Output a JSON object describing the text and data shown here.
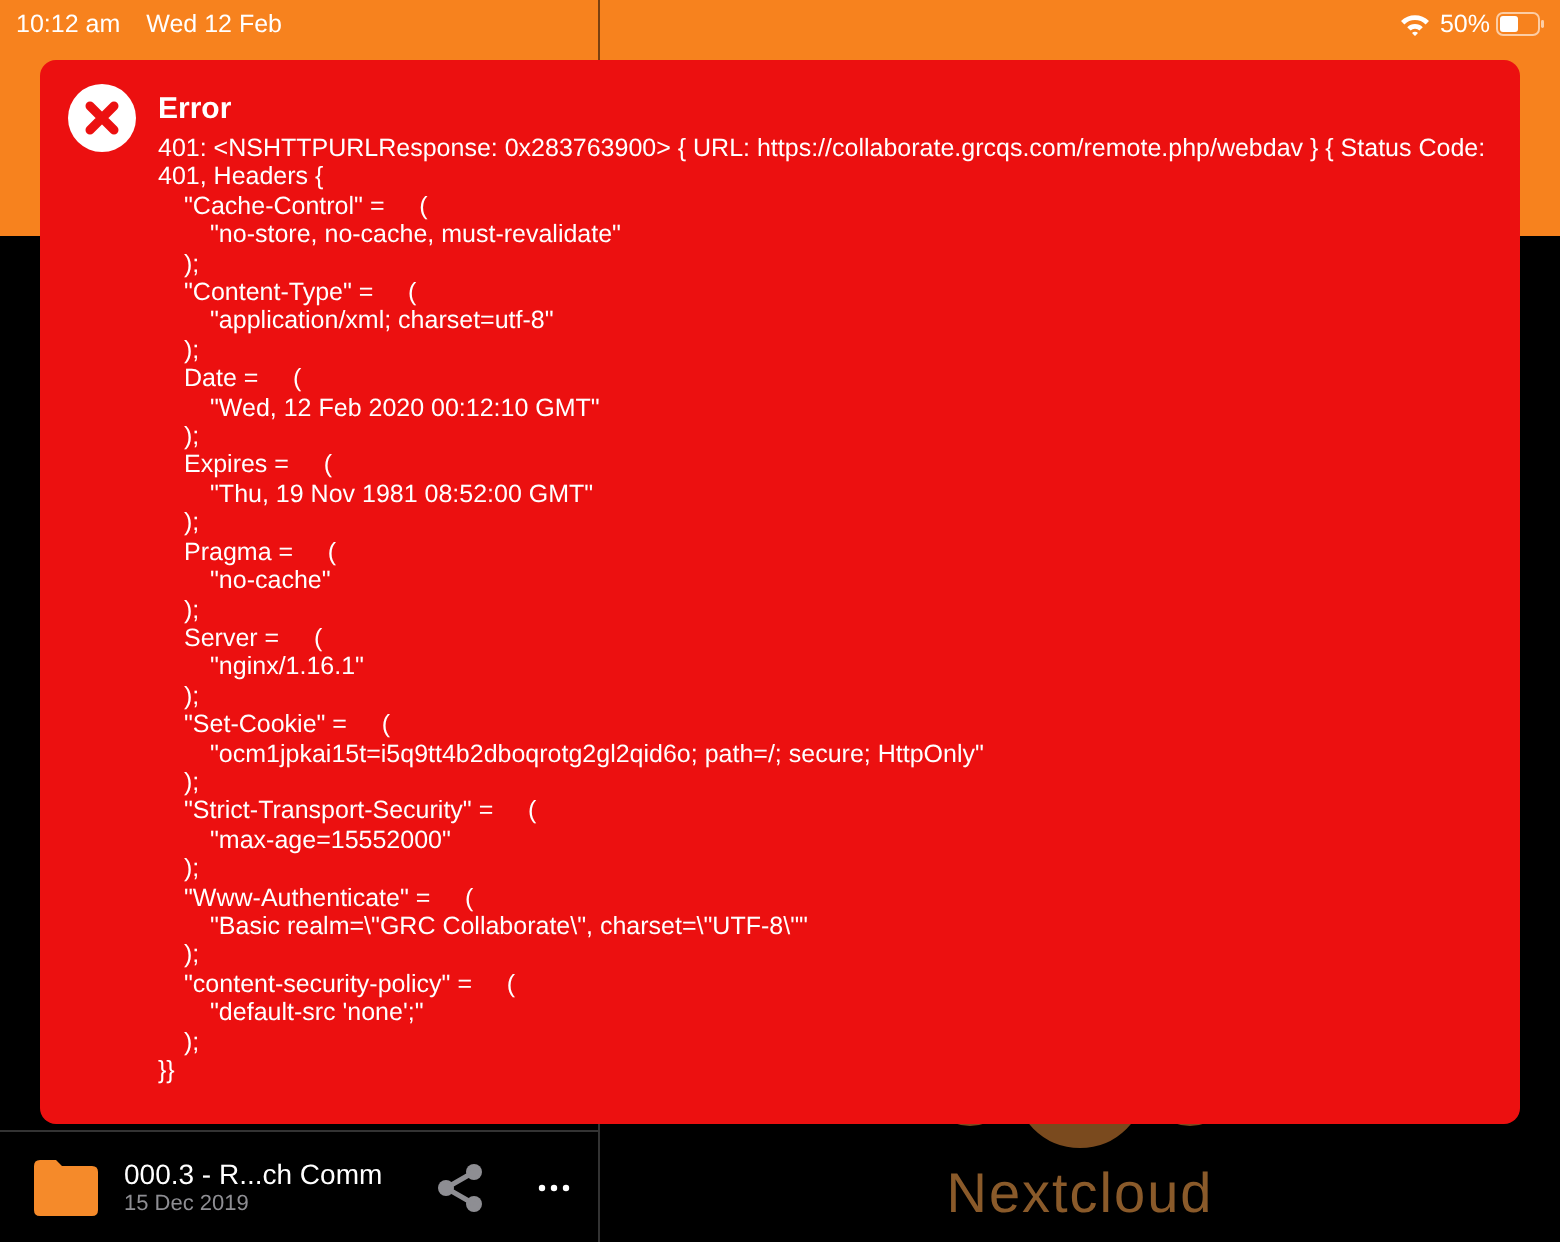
{
  "status_bar": {
    "time": "10:12 am",
    "date": "Wed 12 Feb",
    "battery": "50%"
  },
  "error": {
    "title": "Error",
    "message": "401: <NSHTTPURLResponse: 0x283763900> { URL: https://collaborate.grcqs.com/remote.php/webdav } { Status Code: 401, Headers {",
    "lines": [
      {
        "kind": "key",
        "text": "\"Cache-Control\" =     ("
      },
      {
        "kind": "value",
        "text": "\"no-store, no-cache, must-revalidate\""
      },
      {
        "kind": "close",
        "text": ");"
      },
      {
        "kind": "key",
        "text": "\"Content-Type\" =     ("
      },
      {
        "kind": "value",
        "text": "\"application/xml; charset=utf-8\""
      },
      {
        "kind": "close",
        "text": ");"
      },
      {
        "kind": "key",
        "text": "Date =     ("
      },
      {
        "kind": "value",
        "text": "\"Wed, 12 Feb 2020 00:12:10 GMT\""
      },
      {
        "kind": "close",
        "text": ");"
      },
      {
        "kind": "key",
        "text": "Expires =     ("
      },
      {
        "kind": "value",
        "text": "\"Thu, 19 Nov 1981 08:52:00 GMT\""
      },
      {
        "kind": "close",
        "text": ");"
      },
      {
        "kind": "key",
        "text": "Pragma =     ("
      },
      {
        "kind": "value",
        "text": "\"no-cache\""
      },
      {
        "kind": "close",
        "text": ");"
      },
      {
        "kind": "key",
        "text": "Server =     ("
      },
      {
        "kind": "value",
        "text": "\"nginx/1.16.1\""
      },
      {
        "kind": "close",
        "text": ");"
      },
      {
        "kind": "key",
        "text": "\"Set-Cookie\" =     ("
      },
      {
        "kind": "value",
        "text": "\"ocm1jpkai15t=i5q9tt4b2dboqrotg2gl2qid6o; path=/; secure; HttpOnly\""
      },
      {
        "kind": "close",
        "text": ");"
      },
      {
        "kind": "key",
        "text": "\"Strict-Transport-Security\" =     ("
      },
      {
        "kind": "value",
        "text": "\"max-age=15552000\""
      },
      {
        "kind": "close",
        "text": ");"
      },
      {
        "kind": "key",
        "text": "\"Www-Authenticate\" =     ("
      },
      {
        "kind": "value",
        "text": "\"Basic realm=\\\"GRC Collaborate\\\", charset=\\\"UTF-8\\\"\""
      },
      {
        "kind": "close",
        "text": ");"
      },
      {
        "kind": "key",
        "text": "\"content-security-policy\" =     ("
      },
      {
        "kind": "value",
        "text": "\"default-src 'none';\""
      },
      {
        "kind": "close",
        "text": ");"
      },
      {
        "kind": "end",
        "text": "}}"
      }
    ]
  },
  "files": [
    {
      "name": "000.3 - R...ch Comm",
      "date": "15 Dec 2019"
    }
  ],
  "brand": {
    "name": "Nextcloud"
  }
}
